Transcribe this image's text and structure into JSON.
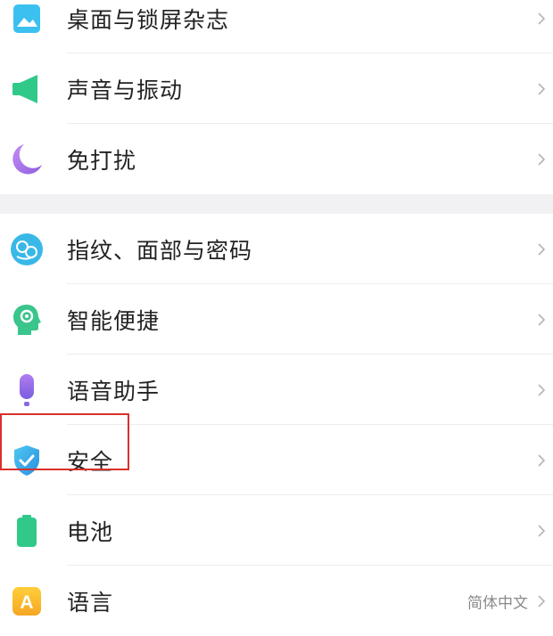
{
  "group1": [
    {
      "name": "wallpaper-lockscreen",
      "label": "桌面与锁屏杂志",
      "icon": "wallpaper-icon"
    },
    {
      "name": "sound-vibration",
      "label": "声音与振动",
      "icon": "speaker-icon"
    },
    {
      "name": "do-not-disturb",
      "label": "免打扰",
      "icon": "moon-icon"
    }
  ],
  "group2": [
    {
      "name": "fingerprint-face-password",
      "label": "指纹、面部与密码",
      "icon": "fingerprint-icon"
    },
    {
      "name": "smart-convenience",
      "label": "智能便捷",
      "icon": "smart-head-icon"
    },
    {
      "name": "voice-assistant",
      "label": "语音助手",
      "icon": "microphone-icon"
    },
    {
      "name": "security",
      "label": "安全",
      "icon": "shield-check-icon"
    },
    {
      "name": "battery",
      "label": "电池",
      "icon": "battery-icon"
    },
    {
      "name": "language",
      "label": "语言",
      "icon": "language-icon",
      "value": "简体中文"
    }
  ],
  "icon_text": {
    "language": "A"
  },
  "colors": {
    "highlight_box": "#d9302b",
    "section_gap": "#f1f1f3",
    "chevron": "#b5b5b5"
  }
}
